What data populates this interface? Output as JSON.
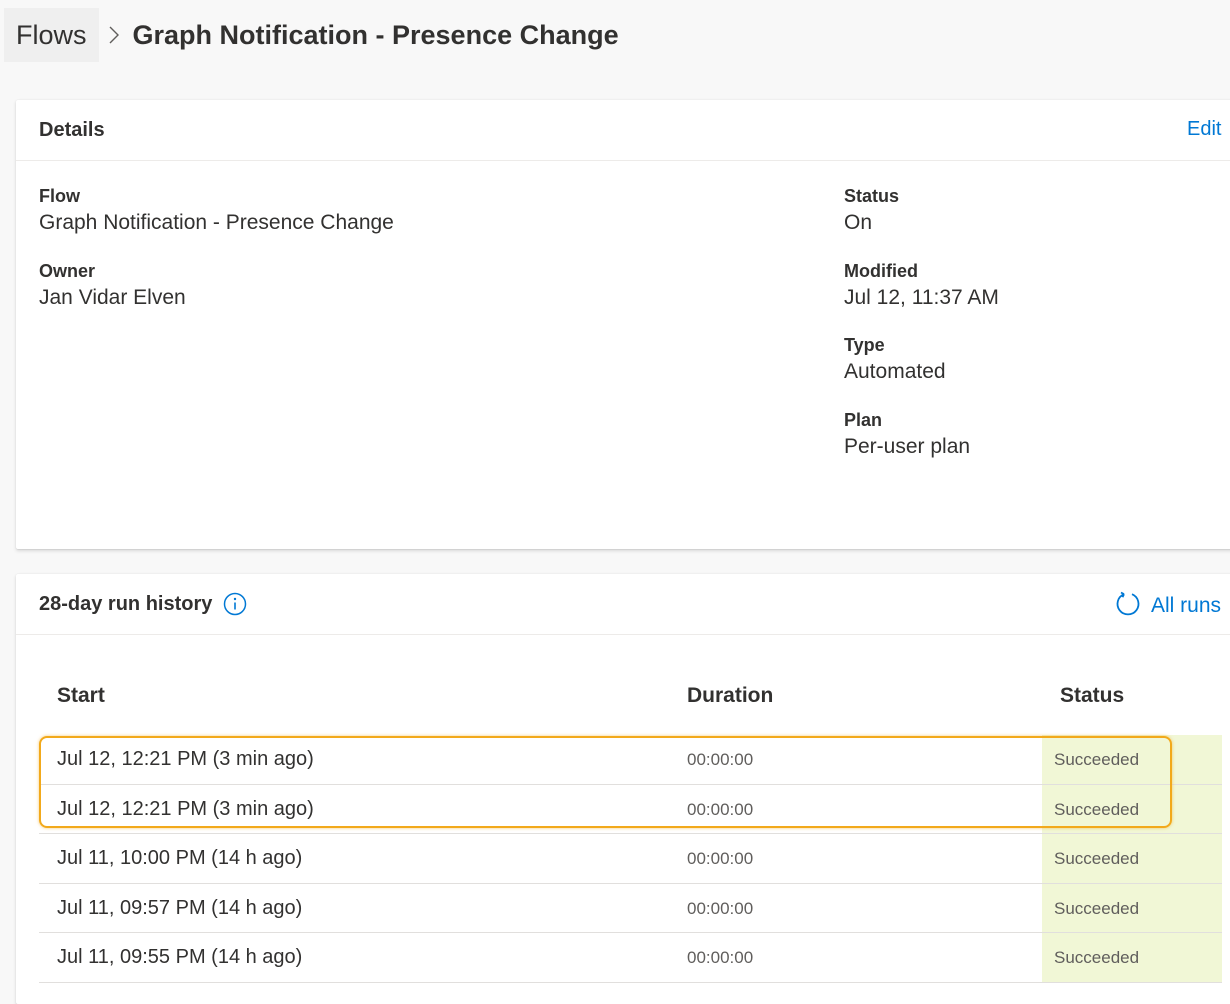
{
  "breadcrumb": {
    "parent": "Flows",
    "current": "Graph Notification - Presence Change"
  },
  "details": {
    "title": "Details",
    "edit_label": "Edit",
    "flow_label": "Flow",
    "flow_value": "Graph Notification - Presence Change",
    "owner_label": "Owner",
    "owner_value": "Jan Vidar Elven",
    "status_label": "Status",
    "status_value": "On",
    "modified_label": "Modified",
    "modified_value": "Jul 12, 11:37 AM",
    "type_label": "Type",
    "type_value": "Automated",
    "plan_label": "Plan",
    "plan_value": "Per-user plan"
  },
  "history": {
    "title": "28-day run history",
    "all_runs_label": "All runs",
    "columns": {
      "start": "Start",
      "duration": "Duration",
      "status": "Status"
    },
    "rows": [
      {
        "start": "Jul 12, 12:21 PM (3 min ago)",
        "duration": "00:00:00",
        "status": "Succeeded"
      },
      {
        "start": "Jul 12, 12:21 PM (3 min ago)",
        "duration": "00:00:00",
        "status": "Succeeded"
      },
      {
        "start": "Jul 11, 10:00 PM (14 h ago)",
        "duration": "00:00:00",
        "status": "Succeeded"
      },
      {
        "start": "Jul 11, 09:57 PM (14 h ago)",
        "duration": "00:00:00",
        "status": "Succeeded"
      },
      {
        "start": "Jul 11, 09:55 PM (14 h ago)",
        "duration": "00:00:00",
        "status": "Succeeded"
      }
    ]
  },
  "colors": {
    "accent": "#0078d4",
    "success_bg": "#f1f7d6",
    "highlight": "#f2a91b"
  },
  "icons": {
    "breadcrumb_separator": "chevron-right-icon",
    "info": "info-icon",
    "refresh": "refresh-icon"
  }
}
